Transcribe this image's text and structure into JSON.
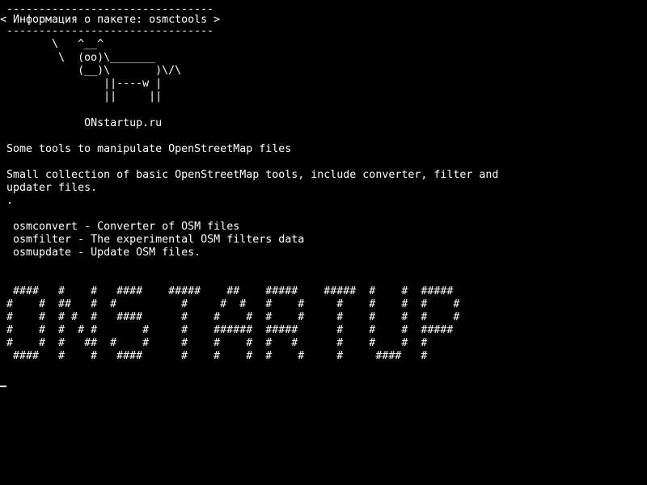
{
  "terminal": {
    "lines": [
      " --------------------------------",
      "< Информация о пакете: osmctools >",
      " --------------------------------",
      "        \\   ^__^",
      "         \\  (oo)\\_______",
      "            (__)\\       )\\/\\",
      "                ||----w |",
      "                ||     ||",
      "",
      "             ONstartup.ru",
      "",
      " Some tools to manipulate OpenStreetMap files",
      "",
      " Small collection of basic OpenStreetMap tools, include converter, filter and",
      " updater files.",
      " .",
      "",
      "  osmconvert - Converter of OSM files",
      "  osmfilter - The experimental OSM filters data",
      "  osmupdate - Update OSM files.",
      "",
      "",
      "  ####   #    #   ####    #####    ##    #####    #####  #    #  #####",
      " #    #  ##   #  #          #     #  #   #    #     #    #    #  #    #",
      " #    #  # #  #   ####      #    #    #  #    #     #    #    #  #    #",
      " #    #  #  # #       #     #    ######  #####      #    #    #  #####",
      " #    #  #   ##  #    #     #    #    #  #   #      #    #    #  #",
      "  ####   #    #   ####      #    #    #  #    #     #     ####   #"
    ],
    "cursor": "_",
    "text_color": "#ffffff",
    "background_color": "#000000"
  }
}
